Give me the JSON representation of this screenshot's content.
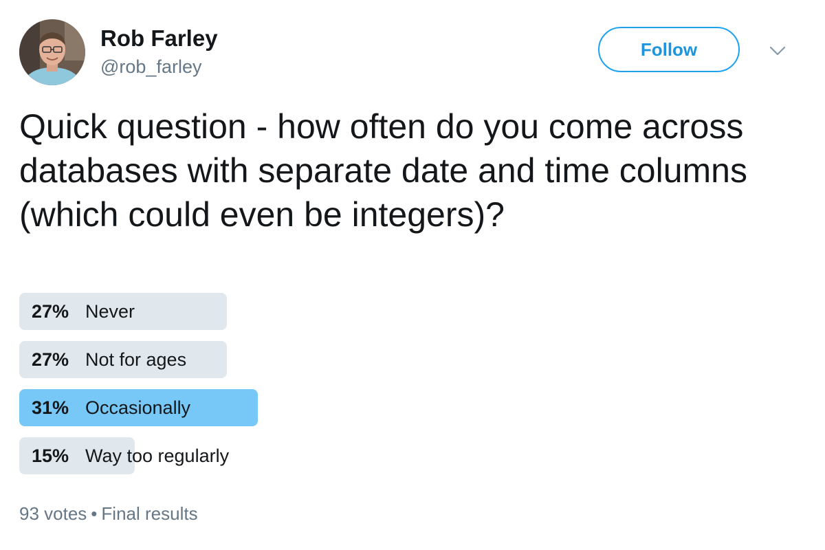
{
  "author": {
    "display_name": "Rob Farley",
    "screen_name": "@rob_farley",
    "avatar_icon": "user-avatar-photo"
  },
  "actions": {
    "follow_label": "Follow",
    "caret_icon": "chevron-down-icon"
  },
  "tweet": {
    "text": "Quick question - how often do you come across databases with separate date and time columns (which could even be integers)?"
  },
  "poll": {
    "choices": [
      {
        "percent_label": "27%",
        "label": "Never",
        "percent": 27,
        "leader": false
      },
      {
        "percent_label": "27%",
        "label": "Not for ages",
        "percent": 27,
        "leader": false
      },
      {
        "percent_label": "31%",
        "label": "Occasionally",
        "percent": 31,
        "leader": true
      },
      {
        "percent_label": "15%",
        "label": "Way too regularly",
        "percent": 15,
        "leader": false
      }
    ],
    "votes": "93 votes",
    "separator": "•",
    "status": "Final results"
  },
  "colors": {
    "bar": "#e1e8ed",
    "leader_bar": "#77c7f7",
    "accent": "#1da1f2",
    "muted_text": "#657786"
  }
}
